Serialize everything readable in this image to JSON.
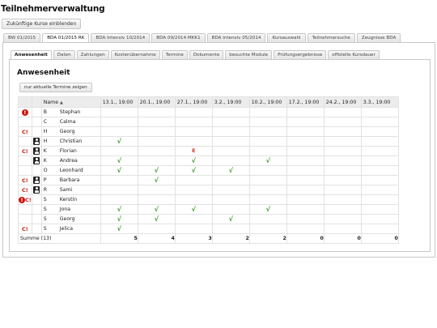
{
  "page": {
    "title": "Teilnehmerverwaltung"
  },
  "toolbar": {
    "show_future_courses": "Zukünftige Kurse einblenden"
  },
  "course_tabs": [
    {
      "label": "BW 01/2015",
      "active": false
    },
    {
      "label": "BDA 01/2015 RK",
      "active": true
    },
    {
      "label": "BDA Intensiv 10/2014",
      "active": false
    },
    {
      "label": "BDA 09/2014 MKK1",
      "active": false
    },
    {
      "label": "BDA Intensiv 05/2014",
      "active": false
    },
    {
      "label": "Kursauswahl",
      "active": false
    },
    {
      "label": "Teilnehmersuche",
      "active": false
    },
    {
      "label": "Zeugnisse BDA",
      "active": false
    }
  ],
  "sub_tabs": [
    {
      "label": "Anwesenheit",
      "active": true
    },
    {
      "label": "Daten",
      "active": false
    },
    {
      "label": "Zahlungen",
      "active": false
    },
    {
      "label": "Kostenübernahme",
      "active": false
    },
    {
      "label": "Termine",
      "active": false
    },
    {
      "label": "Dokumente",
      "active": false
    },
    {
      "label": "besuchte Module",
      "active": false
    },
    {
      "label": "Prüfungsergebnisse",
      "active": false
    },
    {
      "label": "offizielle Kursdauer",
      "active": false
    }
  ],
  "attendance": {
    "heading": "Anwesenheit",
    "filter_button": "nur aktuelle Termine zeigen",
    "name_header": "Name",
    "sort_indicator": "▲",
    "dates": [
      "13.1., 19:00",
      "20.1., 19:00",
      "27.1., 19:00",
      "3.2., 19:00",
      "10.2., 19:00",
      "17.2., 19:00",
      "24.2., 19:00",
      "3.3., 19:00"
    ],
    "check_glyph": "√",
    "excused_glyph": "E",
    "rows": [
      {
        "flag": "warning",
        "icon": "",
        "initial": "B",
        "name": "Stephan",
        "marks": [
          "",
          "",
          "",
          "",
          "",
          "",
          "",
          ""
        ]
      },
      {
        "flag": "",
        "icon": "",
        "initial": "C",
        "name": "Calma",
        "marks": [
          "",
          "",
          "",
          "",
          "",
          "",
          "",
          ""
        ]
      },
      {
        "flag": "c-alert",
        "icon": "",
        "initial": "H",
        "name": "Georg",
        "marks": [
          "",
          "",
          "",
          "",
          "",
          "",
          "",
          ""
        ]
      },
      {
        "flag": "",
        "icon": "person",
        "initial": "H",
        "name": "Christian",
        "marks": [
          "check",
          "",
          "",
          "",
          "",
          "",
          "",
          ""
        ]
      },
      {
        "flag": "c-alert",
        "icon": "person",
        "initial": "K",
        "name": "Florian",
        "marks": [
          "",
          "",
          "excused",
          "",
          "",
          "",
          "",
          ""
        ]
      },
      {
        "flag": "",
        "icon": "person",
        "initial": "K",
        "name": "Andrea",
        "marks": [
          "check",
          "",
          "check",
          "",
          "check",
          "",
          "",
          ""
        ]
      },
      {
        "flag": "",
        "icon": "",
        "initial": "O",
        "name": "Leonhard",
        "marks": [
          "check",
          "check",
          "check",
          "check",
          "",
          "",
          "",
          ""
        ]
      },
      {
        "flag": "c-alert",
        "icon": "person",
        "initial": "P",
        "name": "Barbara",
        "marks": [
          "",
          "check",
          "",
          "",
          "",
          "",
          "",
          ""
        ]
      },
      {
        "flag": "c-alert",
        "icon": "person",
        "initial": "R",
        "name": "Sami",
        "marks": [
          "",
          "",
          "",
          "",
          "",
          "",
          "",
          ""
        ]
      },
      {
        "flag": "warning-c",
        "icon": "",
        "initial": "S",
        "name": "Kerstin",
        "marks": [
          "",
          "",
          "",
          "",
          "",
          "",
          "",
          ""
        ]
      },
      {
        "flag": "",
        "icon": "",
        "initial": "S",
        "name": "Jona",
        "marks": [
          "check",
          "check",
          "check",
          "",
          "check",
          "",
          "",
          ""
        ]
      },
      {
        "flag": "",
        "icon": "",
        "initial": "S",
        "name": "Georg",
        "marks": [
          "check",
          "check",
          "",
          "check",
          "",
          "",
          "",
          ""
        ]
      },
      {
        "flag": "c-alert",
        "icon": "",
        "initial": "S",
        "name": "Jelica",
        "marks": [
          "check",
          "",
          "",
          "",
          "",
          "",
          "",
          ""
        ]
      }
    ],
    "sum_label": "Summe (13)",
    "sums": [
      "5",
      "4",
      "3",
      "2",
      "2",
      "0",
      "0",
      "0"
    ]
  },
  "colors": {
    "check": "#2e9a1c",
    "alert": "#c8170c",
    "header_bg": "#ececec"
  }
}
